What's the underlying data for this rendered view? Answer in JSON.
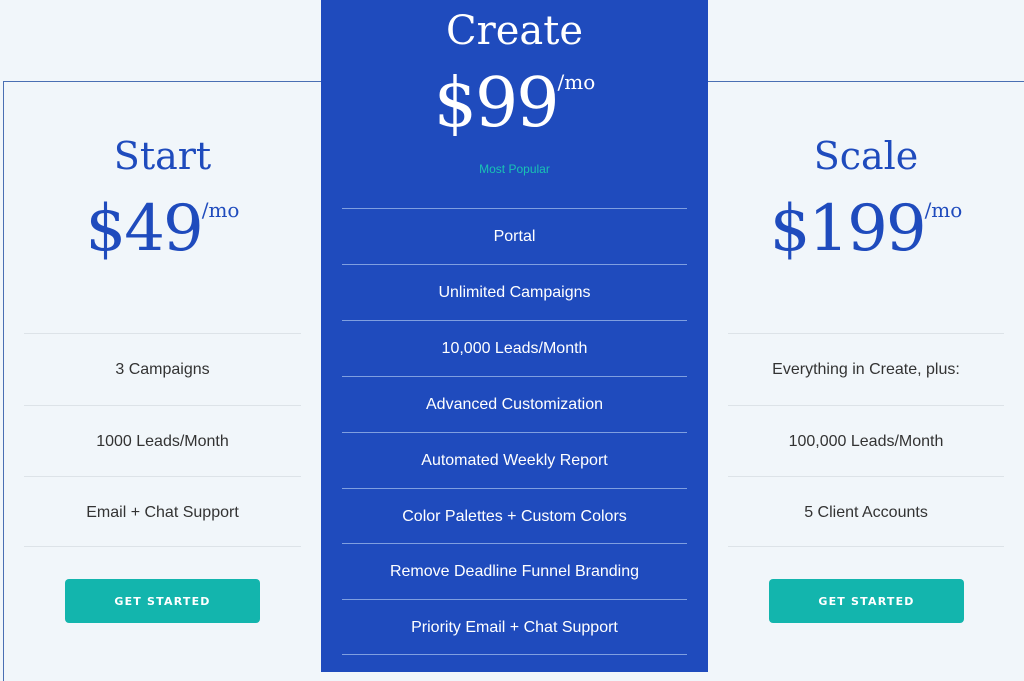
{
  "plans": [
    {
      "name": "Start",
      "price": "$49",
      "period": "/mo",
      "features": [
        "3 Campaigns",
        "1000 Leads/Month",
        "Email + Chat Support"
      ],
      "cta": "GET STARTED"
    },
    {
      "name": "Create",
      "price": "$99",
      "period": "/mo",
      "badge": "Most Popular",
      "features": [
        "Portal",
        "Unlimited Campaigns",
        "10,000 Leads/Month",
        "Advanced Customization",
        "Automated Weekly Report",
        "Color Palettes + Custom Colors",
        "Remove Deadline Funnel Branding",
        "Priority Email + Chat Support"
      ]
    },
    {
      "name": "Scale",
      "price": "$199",
      "period": "/mo",
      "features": [
        "Everything in Create, plus:",
        "100,000 Leads/Month",
        "5 Client Accounts"
      ],
      "cta": "GET STARTED"
    }
  ],
  "colors": {
    "brand": "#1f4bbd",
    "accent": "#13b5ad",
    "background": "#f1f6fa"
  }
}
